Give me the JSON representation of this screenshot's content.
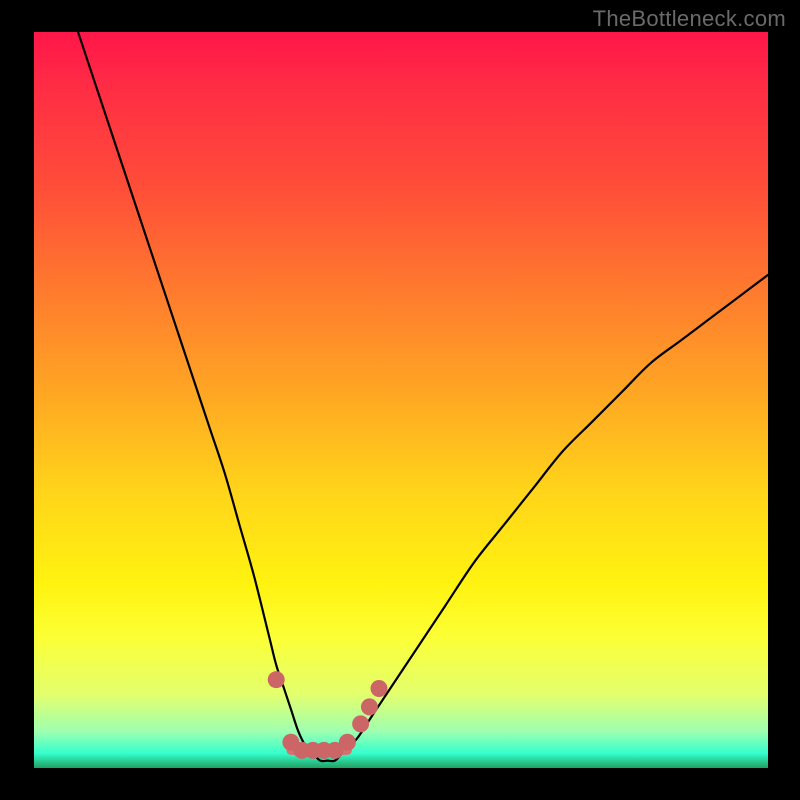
{
  "watermark": "TheBottleneck.com",
  "chart_data": {
    "type": "line",
    "title": "",
    "xlabel": "",
    "ylabel": "",
    "xlim": [
      0,
      100
    ],
    "ylim": [
      0,
      100
    ],
    "series": [
      {
        "name": "bottleneck-curve",
        "x": [
          6,
          8,
          10,
          12,
          14,
          16,
          18,
          20,
          22,
          24,
          26,
          28,
          30,
          32,
          33,
          34,
          35,
          36,
          37,
          38,
          39,
          40,
          41,
          42,
          44,
          46,
          48,
          52,
          56,
          60,
          64,
          68,
          72,
          76,
          80,
          84,
          88,
          92,
          96,
          100
        ],
        "y": [
          100,
          94,
          88,
          82,
          76,
          70,
          64,
          58,
          52,
          46,
          40,
          33,
          26,
          18,
          14,
          11,
          8,
          5,
          3,
          2,
          1,
          1,
          1,
          2,
          4,
          7,
          10,
          16,
          22,
          28,
          33,
          38,
          43,
          47,
          51,
          55,
          58,
          61,
          64,
          67
        ]
      }
    ],
    "markers": [
      {
        "x": 33.0,
        "y": 12.0
      },
      {
        "x": 35.0,
        "y": 3.5
      },
      {
        "x": 36.5,
        "y": 2.4
      },
      {
        "x": 38.0,
        "y": 2.4
      },
      {
        "x": 39.5,
        "y": 2.4
      },
      {
        "x": 41.0,
        "y": 2.4
      },
      {
        "x": 42.7,
        "y": 3.5
      },
      {
        "x": 44.5,
        "y": 6.0
      },
      {
        "x": 45.7,
        "y": 8.3
      },
      {
        "x": 47.0,
        "y": 10.8
      }
    ],
    "colors": {
      "curve": "#000000",
      "markers": "#cc6666",
      "bottom_line": "#d86f70"
    }
  }
}
